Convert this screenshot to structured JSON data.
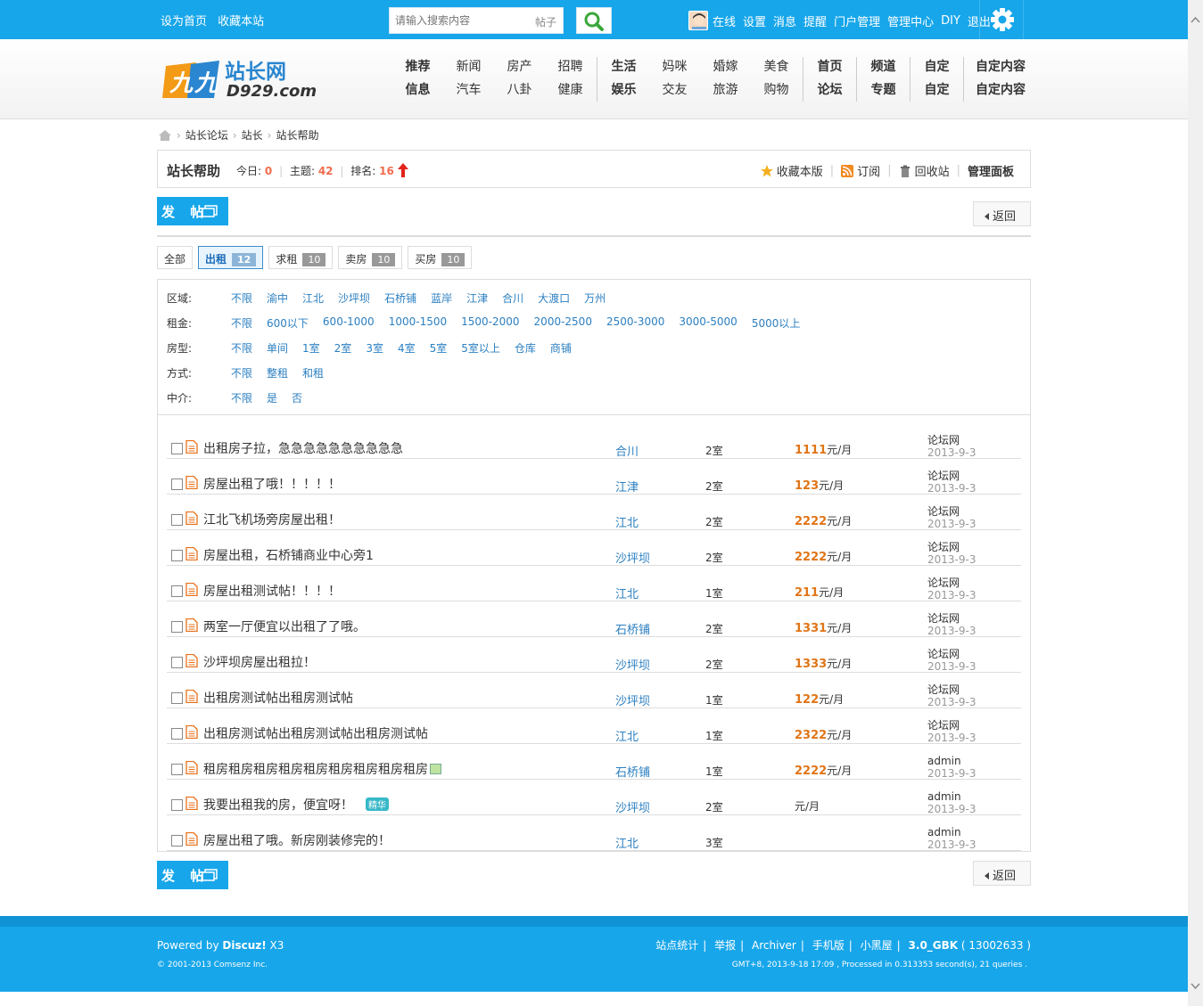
{
  "topbar": {
    "set_home": "设为首页",
    "bookmark": "收藏本站",
    "search_placeholder": "请输入搜索内容",
    "search_type": "帖子",
    "user_links": [
      "在线",
      "设置",
      "消息",
      "提醒",
      "门户管理",
      "管理中心",
      "DIY",
      "退出"
    ]
  },
  "logo": {
    "cn": "站长网",
    "en": "D929.com"
  },
  "nav": [
    {
      "top": "推荐",
      "bottom": "信息",
      "bold": true
    },
    {
      "top": "新闻",
      "bottom": "汽车"
    },
    {
      "top": "房产",
      "bottom": "八卦"
    },
    {
      "top": "招聘",
      "bottom": "健康"
    },
    {
      "top": "生活",
      "bottom": "娱乐",
      "bold": true
    },
    {
      "top": "妈咪",
      "bottom": "交友"
    },
    {
      "top": "婚嫁",
      "bottom": "旅游"
    },
    {
      "top": "美食",
      "bottom": "购物"
    },
    {
      "top": "首页",
      "bottom": "论坛",
      "bold": true
    },
    {
      "top": "频道",
      "bottom": "专题",
      "bold": true
    },
    {
      "top": "自定",
      "bottom": "自定",
      "bold": true
    },
    {
      "top": "自定内容",
      "bottom": "自定内容",
      "bold": true
    }
  ],
  "breadcrumb": [
    "站长论坛",
    "站长",
    "站长帮助"
  ],
  "forum": {
    "title": "站长帮助",
    "today_label": "今日:",
    "today": "0",
    "topics_label": "主题:",
    "topics": "42",
    "rank_label": "排名:",
    "rank": "16",
    "favorite": "收藏本版",
    "subscribe": "订阅",
    "recycle": "回收站",
    "admin_panel": "管理面板"
  },
  "post_button": "发 帖",
  "back_button": "返回",
  "tabs": [
    {
      "label": "全部",
      "count": ""
    },
    {
      "label": "出租",
      "count": "12",
      "active": true
    },
    {
      "label": "求租",
      "count": "10"
    },
    {
      "label": "卖房",
      "count": "10"
    },
    {
      "label": "买房",
      "count": "10"
    }
  ],
  "filters": [
    {
      "label": "区域:",
      "options": [
        "不限",
        "渝中",
        "江北",
        "沙坪坝",
        "石桥铺",
        "蓝岸",
        "江津",
        "合川",
        "大渡口",
        "万州"
      ]
    },
    {
      "label": "租金:",
      "options": [
        "不限",
        "600以下",
        "600-1000",
        "1000-1500",
        "1500-2000",
        "2000-2500",
        "2500-3000",
        "3000-5000",
        "5000以上"
      ]
    },
    {
      "label": "房型:",
      "options": [
        "不限",
        "单间",
        "1室",
        "2室",
        "3室",
        "4室",
        "5室",
        "5室以上",
        "仓库",
        "商铺"
      ]
    },
    {
      "label": "方式:",
      "options": [
        "不限",
        "整租",
        "和租"
      ]
    },
    {
      "label": "中介:",
      "options": [
        "不限",
        "是",
        "否"
      ]
    }
  ],
  "threads": [
    {
      "title": "出租房子拉，急急急急急急急急急急",
      "area": "合川",
      "room": "2室",
      "price": "1111",
      "unit": "元/月",
      "user": "论坛网",
      "date": "2013-9-3"
    },
    {
      "title": "房屋出租了哦！！！！！",
      "area": "江津",
      "room": "2室",
      "price": "123",
      "unit": "元/月",
      "user": "论坛网",
      "date": "2013-9-3"
    },
    {
      "title": "江北飞机场旁房屋出租！",
      "area": "江北",
      "room": "2室",
      "price": "2222",
      "unit": "元/月",
      "user": "论坛网",
      "date": "2013-9-3"
    },
    {
      "title": "房屋出租，石桥铺商业中心旁1",
      "area": "沙坪坝",
      "room": "2室",
      "price": "2222",
      "unit": "元/月",
      "user": "论坛网",
      "date": "2013-9-3"
    },
    {
      "title": "房屋出租测试帖！！！！",
      "area": "江北",
      "room": "1室",
      "price": "211",
      "unit": "元/月",
      "user": "论坛网",
      "date": "2013-9-3"
    },
    {
      "title": "两室一厅便宜以出租了了哦。",
      "area": "石桥铺",
      "room": "2室",
      "price": "1331",
      "unit": "元/月",
      "user": "论坛网",
      "date": "2013-9-3"
    },
    {
      "title": "沙坪坝房屋出租拉！",
      "area": "沙坪坝",
      "room": "2室",
      "price": "1333",
      "unit": "元/月",
      "user": "论坛网",
      "date": "2013-9-3"
    },
    {
      "title": "出租房测试帖出租房测试帖",
      "area": "沙坪坝",
      "room": "1室",
      "price": "122",
      "unit": "元/月",
      "user": "论坛网",
      "date": "2013-9-3"
    },
    {
      "title": "出租房测试帖出租房测试帖出租房测试帖",
      "area": "江北",
      "room": "1室",
      "price": "2322",
      "unit": "元/月",
      "user": "论坛网",
      "date": "2013-9-3"
    },
    {
      "title": "租房租房租房租房租房租房租房租房租房",
      "area": "石桥铺",
      "room": "1室",
      "price": "2222",
      "unit": "元/月",
      "user": "admin",
      "date": "2013-9-3",
      "image": true
    },
    {
      "title": "我要出租我的房，便宜呀！",
      "area": "沙坪坝",
      "room": "2室",
      "price": "",
      "unit": "元/月",
      "user": "admin",
      "date": "2013-9-3",
      "badge": "精华"
    },
    {
      "title": "房屋出租了哦。新房刚装修完的！",
      "area": "江北",
      "room": "3室",
      "price": "",
      "unit": "",
      "user": "admin",
      "date": "2013-9-3"
    }
  ],
  "footer": {
    "powered_prefix": "Powered by ",
    "powered_brand": "Discuz!",
    "powered_version": " X3",
    "copyright": "© 2001-2013 Comsenz Inc.",
    "links": [
      "站点统计",
      "举报",
      "Archiver",
      "手机版",
      "小黑屋"
    ],
    "version": "3.0_GBK",
    "build": "( 13002633 )",
    "gmt": "GMT+8, 2013-9-18 17:09 , Processed in 0.313353 second(s), 21 queries ."
  }
}
